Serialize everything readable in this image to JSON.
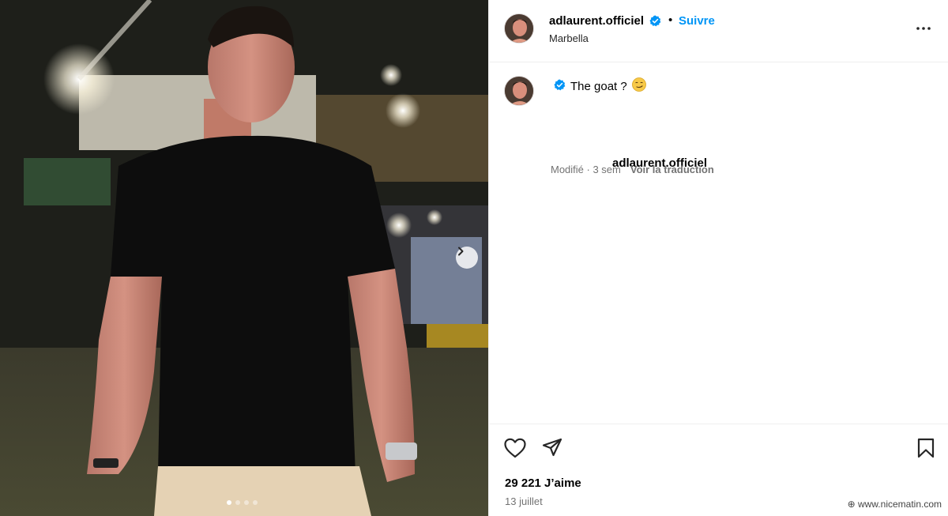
{
  "post": {
    "username": "adlaurent.officiel",
    "follow_label": "Suivre",
    "separator": "•",
    "location": "Marbella",
    "caption_username": "adlaurent.officiel",
    "caption_text": "The goat ?",
    "edited_label": "Modifié · 3 sem",
    "translate_label": "Voir la traduction",
    "likes": "29 221 J’aime",
    "date": "13 juillet",
    "carousel_count": 4,
    "carousel_index": 1
  },
  "watermark": "www.nicematin.com",
  "colors": {
    "accent": "#0095f6",
    "verified": "#0095f6",
    "muted": "#737373"
  },
  "icons": {
    "more": "more-icon",
    "verified": "verified-badge-icon",
    "like": "heart-icon",
    "share": "paper-plane-icon",
    "save": "bookmark-icon",
    "next": "chevron-right-icon"
  }
}
